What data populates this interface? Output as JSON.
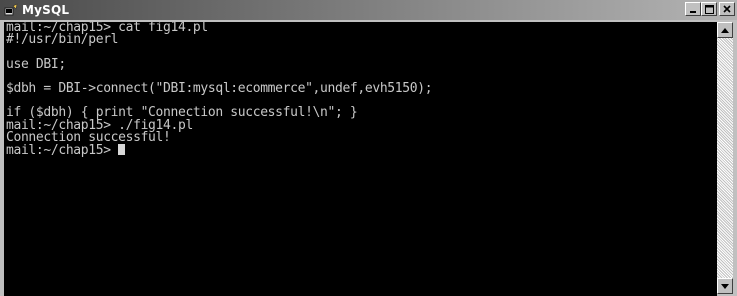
{
  "window": {
    "title": "MySQL"
  },
  "terminal": {
    "lines": [
      "mail:~/chap15> cat fig14.pl",
      "#!/usr/bin/perl",
      "",
      "use DBI;",
      "",
      "$dbh = DBI->connect(\"DBI:mysql:ecommerce\",undef,evh5150);",
      "",
      "if ($dbh) { print \"Connection successful!\\n\"; }",
      "mail:~/chap15> ./fig14.pl",
      "Connection successful!",
      "mail:~/chap15> "
    ]
  },
  "icons": {
    "title": "terminal-window-icon",
    "minimize": "minimize-icon",
    "maximize": "maximize-icon",
    "close": "close-icon",
    "scroll_up": "scroll-up-arrow-icon",
    "scroll_down": "scroll-down-arrow-icon"
  },
  "colors": {
    "terminal_bg": "#000000",
    "terminal_fg": "#c8c8c8",
    "titlebar": "#4a4a4a"
  }
}
